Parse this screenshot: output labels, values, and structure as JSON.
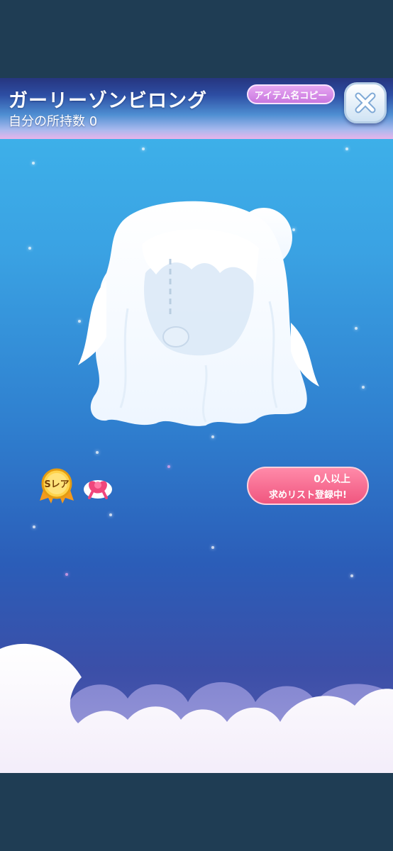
{
  "item": {
    "name": "ガーリーゾンビロング",
    "owned_label": "自分の所持数 0"
  },
  "header": {
    "copy_button_label": "アイテム名コピー",
    "close_icon": "close-x-icon"
  },
  "rarity": {
    "label": "Sレア",
    "icon": "gold-medal-icon"
  },
  "category_icon": "pink-gift-bow-icon",
  "wish_list": {
    "count_text": "0人以上",
    "status_text": "求めリスト登録中!"
  },
  "colors": {
    "accent_pink": "#f0567f",
    "copy_button": "#c977df",
    "header_top": "#26357f",
    "frame": "#1f3d54"
  }
}
